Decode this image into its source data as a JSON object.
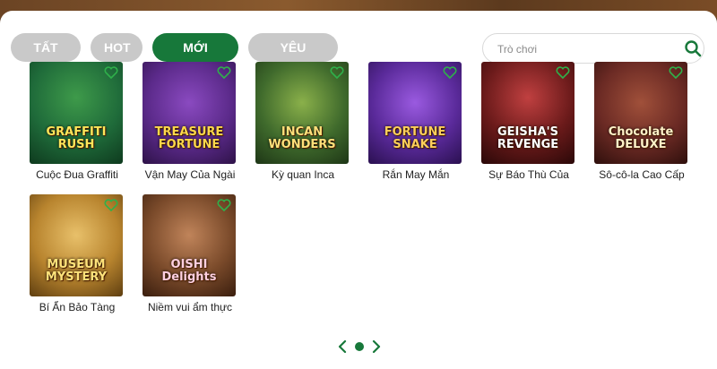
{
  "tabs": [
    {
      "label": "TẤT CẢ",
      "active": false
    },
    {
      "label": "HOT",
      "active": false
    },
    {
      "label": "MỚI NHẤT",
      "active": true
    },
    {
      "label": "YÊU THÍCH",
      "active": false
    }
  ],
  "search": {
    "placeholder": "Trò chơi",
    "icon": "search-icon"
  },
  "colors": {
    "accent": "#17783a",
    "tab_inactive": "#c9c9c9"
  },
  "games": [
    {
      "label": "Cuộc Đua Graffiti",
      "thumb_title": "GRAFFITI RUSH",
      "bg": "#1f6b3a"
    },
    {
      "label": "Vận May Của Ngài",
      "thumb_title": "TREASURE FORTUNE",
      "bg": "#5b2a8a"
    },
    {
      "label": "Kỳ quan Inca",
      "thumb_title": "INCAN WONDERS",
      "bg": "#3f6a2c"
    },
    {
      "label": "Rắn May Mắn",
      "thumb_title": "FORTUNE SNAKE",
      "bg": "#5a2a9a"
    },
    {
      "label": "Sự Báo Thù Của",
      "thumb_title": "GEISHA'S REVENGE",
      "bg": "#6a1a1a"
    },
    {
      "label": "Sô-cô-la Cao Cấp",
      "thumb_title": "Chocolate DELUXE",
      "bg": "#6b2a24"
    },
    {
      "label": "Bí Ẩn Bảo Tàng",
      "thumb_title": "MUSEUM MYSTERY",
      "bg": "#b8842e"
    },
    {
      "label": "Niềm vui ẩm thực",
      "thumb_title": "OISHI Delights",
      "bg": "#7a4a2a"
    }
  ],
  "pager": {
    "current_page": 1,
    "total_pages": 1
  }
}
